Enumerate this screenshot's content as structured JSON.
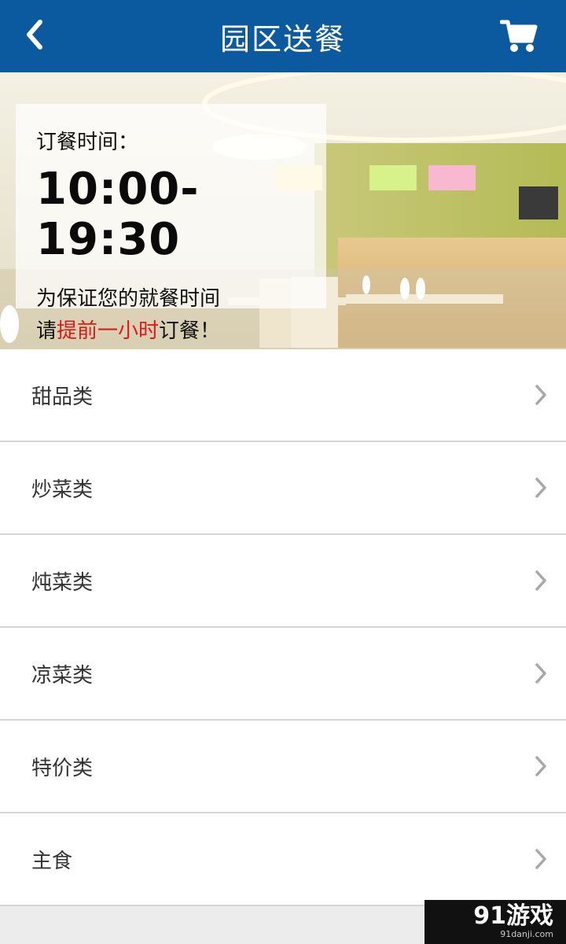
{
  "header": {
    "title": "园区送餐",
    "back_icon": "chevron-left-icon",
    "cart_icon": "cart-icon",
    "color": "#0b5aa0"
  },
  "banner": {
    "label": "订餐时间：",
    "time": "10:00-19:30",
    "line1": "为保证您的就餐时间",
    "line2_prefix": "请",
    "line2_highlight": "提前一小时",
    "line2_suffix": "订餐！",
    "highlight_color": "#e01818"
  },
  "categories": [
    {
      "label": "甜品类"
    },
    {
      "label": "炒菜类"
    },
    {
      "label": "炖菜类"
    },
    {
      "label": "凉菜类"
    },
    {
      "label": "特价类"
    },
    {
      "label": "主食"
    }
  ],
  "watermark": {
    "brand": "91游戏",
    "site": "91danji.com"
  }
}
